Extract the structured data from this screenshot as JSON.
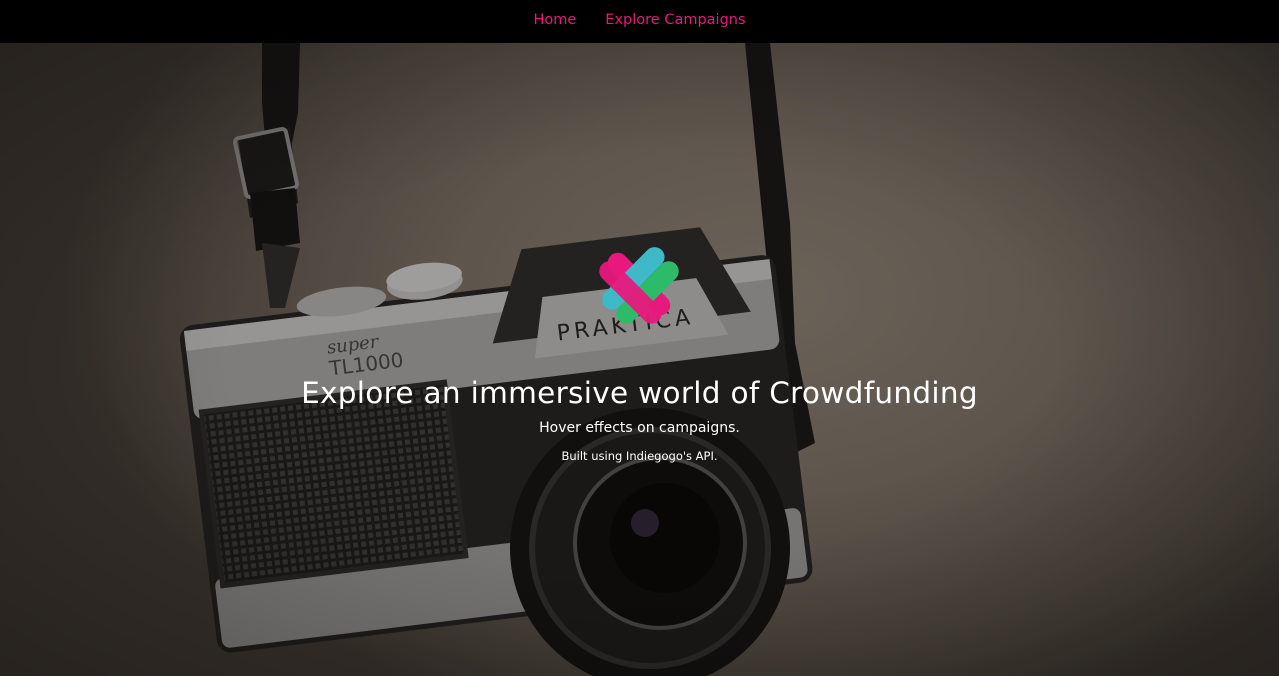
{
  "nav": {
    "items": [
      {
        "label": "Home"
      },
      {
        "label": "Explore Campaigns"
      }
    ],
    "accent": "#e8197d"
  },
  "hero": {
    "title": "Explore an immersive world of Crowdfunding",
    "subtitle": "Hover effects on campaigns.",
    "note": "Built using Indiegogo's API.",
    "background_image": "camera photo",
    "camera_brand": "PRAKTICA",
    "camera_model_line1": "super",
    "camera_model_line2": "TL1000",
    "logo_colors": [
      "#e8197d",
      "#3fb8c8",
      "#2dbb6a"
    ]
  }
}
